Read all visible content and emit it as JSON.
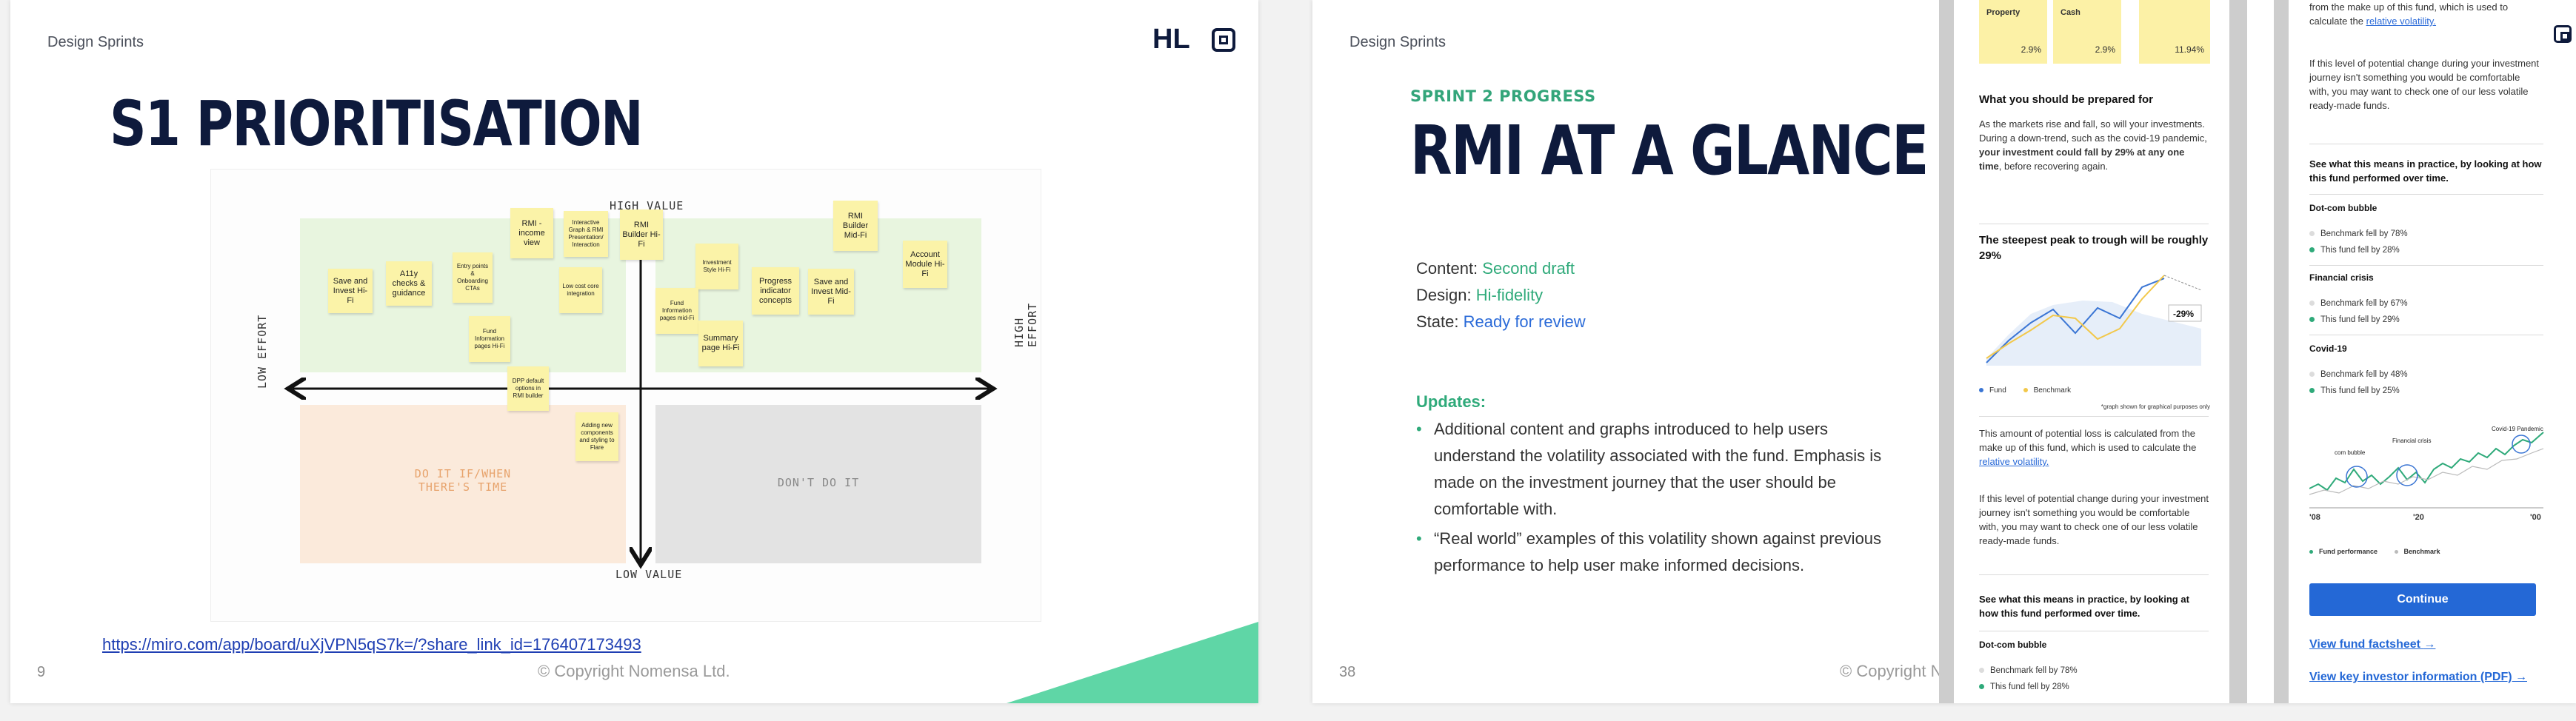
{
  "slide1": {
    "section": "Design Sprints",
    "logo": "HL",
    "title": "S1 PRIORITISATION",
    "axes": {
      "top": "HIGH VALUE",
      "bottom": "LOW VALUE",
      "left": "LOW EFFORT",
      "right": "HIGH EFFORT"
    },
    "quadrants": {
      "bottom_left": [
        "DO IT IF/WHEN",
        "THERE'S TIME"
      ],
      "bottom_right": "DON'T DO IT"
    },
    "stickies": [
      "Save and Invest Hi-Fi",
      "A11y checks & guidance",
      "Entry points & Onboarding CTAs",
      "Fund Information pages Hi-Fi",
      "RMI - income view",
      "Interactive Graph & RMI Presentation/ Interaction",
      "Low cost core integration",
      "RMI Builder Hi-Fi",
      "DPP default options in RMI builder",
      "Adding new components and styling to Flare",
      "Investment Style Hi-Fi",
      "Fund Information pages mid-Fi",
      "Summary page Hi-Fi",
      "Progress indicator concepts",
      "Save and Invest Mid-Fi",
      "RMI Builder Mid-Fi",
      "Account Module Hi-Fi"
    ],
    "link": "https://miro.com/app/board/uXjVPN5qS7k=/?share_link_id=176407173493",
    "page_number": "9",
    "copyright": "© Copyright Nomensa Ltd."
  },
  "slide2": {
    "section": "Design Sprints",
    "kicker": "SPRINT 2 PROGRESS",
    "title": "RMI AT A GLANCE",
    "status": [
      {
        "label": "Content:",
        "value": "Second draft",
        "color": "#2faa7a"
      },
      {
        "label": "Design:",
        "value": "Hi-fidelity",
        "color": "#2faa7a"
      },
      {
        "label": "State:",
        "value": "Ready for review",
        "color": "#2a6ad8"
      }
    ],
    "updates_heading": "Updates:",
    "updates": [
      "Additional content and graphs introduced to help users understand the volatility associated with the fund. Emphasis is made on the investment journey that the user should be comfortable with.",
      "“Real world” examples of this volatility shown against previous performance to help user make informed decisions."
    ],
    "page_number": "38",
    "copyright": "© Copyright Nomensa Ltd."
  },
  "phone1": {
    "tiles": [
      {
        "label": "Property",
        "value": "2.9%"
      },
      {
        "label": "Cash",
        "value": "2.9%"
      },
      {
        "label": "",
        "value": "11.94%"
      }
    ],
    "h1": "What you should be prepared for",
    "p1_a": "As the markets rise and fall, so will your investments. During a down-trend, such as the covid-19 pandemic, ",
    "p1_b": "your investment could fall by 29% at any one time",
    "p1_c": ", before recovering again.",
    "h2": "The steepest peak to trough will be roughly 29%",
    "chart_callout": "-29%",
    "legend_fund": "Fund",
    "legend_benchmark": "Benchmark",
    "footnote": "*graph shown for graphical purposes only",
    "p2": "This amount of potential loss is calculated from the make up of this fund, which is used to calculate the",
    "p2_link": "relative volatility.",
    "p3": "If this level of potential change during your investment journey isn't something you would be comfortable with, you may want to check one of our less volatile ready-made funds.",
    "h3": "See what this means in practice, by looking at how this fund performed over time.",
    "h4": "Dot-com bubble",
    "bench": "Benchmark fell by 78%",
    "fund": "This fund fell by 28%"
  },
  "phone2": {
    "p0": "from the make up of this fund, which is used to calculate the",
    "p0_link": "relative volatility.",
    "p1": "If this level of potential change during your investment journey isn't something you would be comfortable with, you may want to check one of our less volatile ready-made funds.",
    "h1": "See what this means in practice, by looking at how this fund performed over time.",
    "events": [
      {
        "name": "Dot-com bubble",
        "bench": "Benchmark fell by 78%",
        "fund": "This fund fell by 28%"
      },
      {
        "name": "Financial crisis",
        "bench": "Benchmark fell by 67%",
        "fund": "This fund fell by 29%"
      },
      {
        "name": "Covid-19",
        "bench": "Benchmark fell by 48%",
        "fund": "This fund fell by 25%"
      }
    ],
    "chart_labels": {
      "a": "com bubble",
      "b": "Financial crisis",
      "c": "Covid-19 Pandemic"
    },
    "x_ticks": [
      "'08",
      "'20",
      "'00"
    ],
    "legend_fund": "Fund performance",
    "legend_benchmark": "Benchmark",
    "cta": "Continue",
    "link1": "View fund factsheet",
    "link2": "View key investor information (PDF)"
  },
  "colors": {
    "navy": "#0e1a3c",
    "green": "#2faa7a",
    "blue": "#2468d6",
    "sticky": "#fbf3a8",
    "accent_green": "#5fd6a6"
  }
}
